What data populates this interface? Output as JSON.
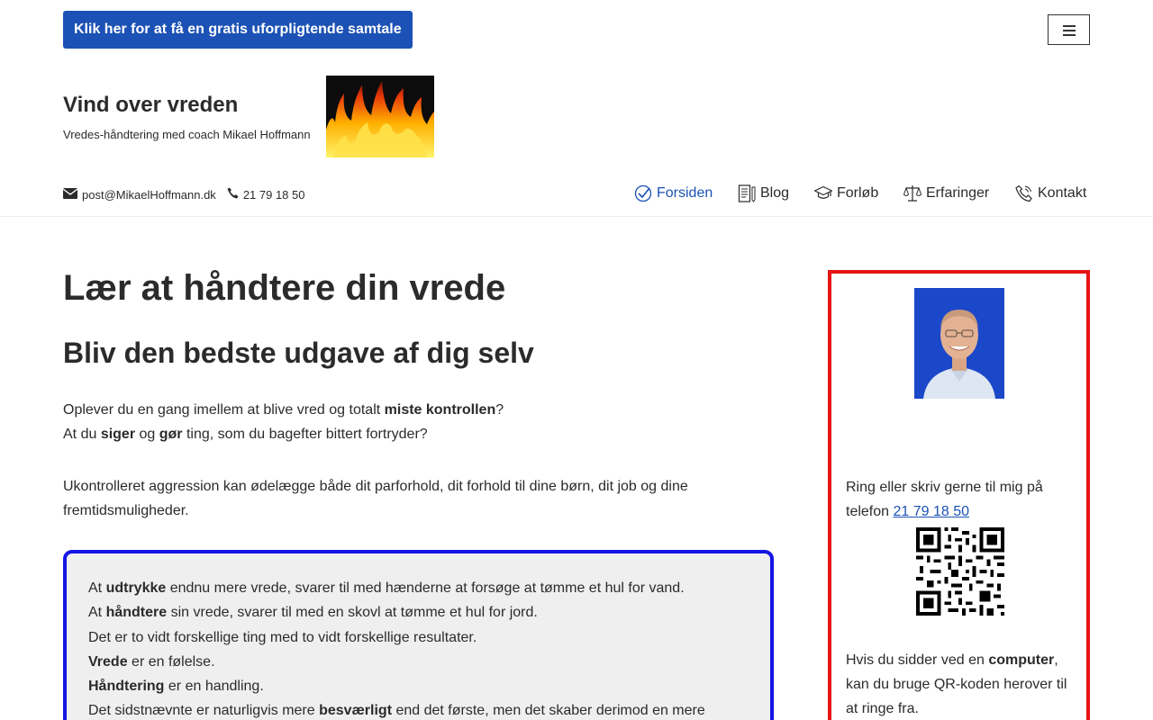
{
  "topbar": {
    "cta_label": "Klik her for at få en gratis uforpligtende samtale"
  },
  "site": {
    "title": "Vind over vreden",
    "tagline": "Vredes-håndtering med coach Mikael Hoffmann"
  },
  "contact": {
    "email": "post@MikaelHoffmann.dk",
    "phone": "21 79 18 50"
  },
  "nav": {
    "items": [
      {
        "label": "Forsiden",
        "icon": "check-circle-icon",
        "active": true
      },
      {
        "label": "Blog",
        "icon": "document-icon"
      },
      {
        "label": "Forløb",
        "icon": "graduation-cap-icon"
      },
      {
        "label": "Erfaringer",
        "icon": "scales-icon"
      },
      {
        "label": "Kontakt",
        "icon": "phone-icon"
      }
    ]
  },
  "main": {
    "heading": "Lær at håndtere din vrede",
    "subheading": "Bliv den bedste udgave af dig selv",
    "p1": {
      "a": "Oplever du en gang imellem at blive vred og totalt ",
      "b": "miste kontrollen",
      "c": "?"
    },
    "p2": {
      "a": "At du ",
      "b": "siger",
      "c": " og ",
      "d": "gør",
      "e": " ting, som du bagefter bittert fortryder?"
    },
    "p3": "Ukontrolleret aggression kan ødelægge både dit parforhold, dit forhold til dine børn, dit job og dine fremtidsmuligheder.",
    "box": {
      "l1": {
        "a": "At ",
        "b": "udtrykke",
        "c": " endnu mere vrede, svarer til med hænderne at forsøge at tømme et hul for vand."
      },
      "l2": {
        "a": "At ",
        "b": "håndtere",
        "c": " sin vrede, svarer til med en skovl at tømme et hul for jord."
      },
      "l3": "Det er to vidt forskellige ting med to vidt forskellige resultater.",
      "l4": {
        "b": "Vrede",
        "c": " er en følelse."
      },
      "l5": {
        "b": "Håndtering",
        "c": " er en handling."
      },
      "l6": {
        "a": "Det sidstnævnte er naturligvis mere ",
        "b": "besværligt",
        "c": " end det første, men det skaber derimod en mere"
      }
    }
  },
  "sidebar": {
    "call_text": "Ring eller skriv gerne til mig på telefon ",
    "phone_link": "21 79 18 50",
    "qr_text": {
      "a": "Hvis du sidder ved en ",
      "b": "computer",
      "c": ", kan du bruge QR-koden herover til at ringe fra."
    }
  },
  "colors": {
    "accent": "#1c52b5",
    "box_border": "#1414e6",
    "sidebar_border": "#e61414"
  }
}
